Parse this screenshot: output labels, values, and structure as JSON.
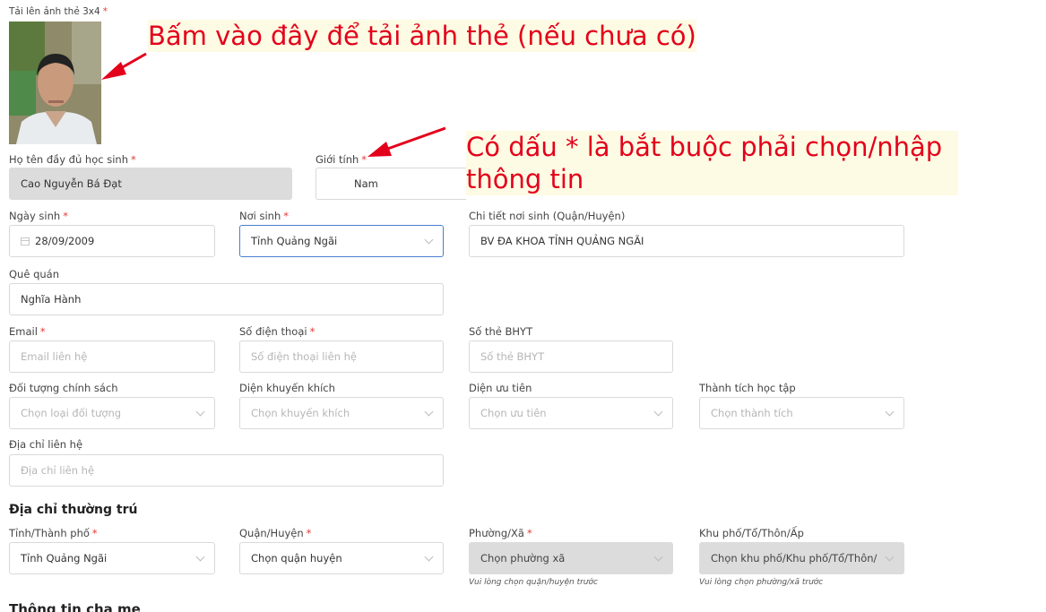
{
  "photo": {
    "label": "Tải lên ảnh thẻ 3x4",
    "required": "*"
  },
  "annotations": {
    "upload_hint": "Bấm vào đây để tải ảnh thẻ (nếu chưa có)",
    "required_hint_line1": "Có dấu * là bắt buộc phải chọn/nhập",
    "required_hint_line2": "thông tin"
  },
  "fields": {
    "full_name": {
      "label": "Họ tên đầy đủ học sinh",
      "required": "*",
      "value": "Cao Nguyễn Bá Đạt"
    },
    "gender": {
      "label": "Giới tính",
      "required": "*",
      "value": "Nam"
    },
    "dob": {
      "label": "Ngày sinh",
      "required": "*",
      "value": "28/09/2009"
    },
    "birthplace": {
      "label": "Nơi sinh",
      "required": "*",
      "value": "Tỉnh Quảng Ngãi"
    },
    "birthplace_detail": {
      "label": "Chi tiết nơi sinh (Quận/Huyện)",
      "value": "BV ĐA KHOA TỈNH QUẢNG NGÃI"
    },
    "hometown": {
      "label": "Quê quán",
      "value": "Nghĩa Hành"
    },
    "email": {
      "label": "Email",
      "required": "*",
      "placeholder": "Email liên hệ"
    },
    "phone": {
      "label": "Số điện thoại",
      "required": "*",
      "placeholder": "Số điện thoại liên hệ"
    },
    "insurance": {
      "label": "Số thẻ BHYT",
      "placeholder": "Số thẻ BHYT"
    },
    "policy": {
      "label": "Đối tượng chính sách",
      "placeholder": "Chọn loại đối tượng"
    },
    "encourage": {
      "label": "Diện khuyến khích",
      "placeholder": "Chọn khuyến khích"
    },
    "priority": {
      "label": "Diện ưu tiên",
      "placeholder": "Chọn ưu tiên"
    },
    "achievement": {
      "label": "Thành tích học tập",
      "placeholder": "Chọn thành tích"
    },
    "contact_address": {
      "label": "Địa chỉ liên hệ",
      "placeholder": "Địa chỉ liên hệ"
    }
  },
  "residence": {
    "title": "Địa chỉ thường trú",
    "province": {
      "label": "Tỉnh/Thành phố",
      "required": "*",
      "value": "Tỉnh Quảng Ngãi"
    },
    "district": {
      "label": "Quận/Huyện",
      "required": "*",
      "placeholder": "Chọn quận huyện"
    },
    "ward": {
      "label": "Phường/Xã",
      "required": "*",
      "placeholder": "Chọn phường xã",
      "hint": "Vui lòng chọn quận/huyện trước"
    },
    "hamlet": {
      "label": "Khu phố/Tổ/Thôn/Ấp",
      "placeholder": "Chọn khu phố/Khu phố/Tổ/Thôn/",
      "hint": "Vui lòng chọn phường/xã trước"
    }
  },
  "next_section": {
    "title": "Thông tin cha mẹ"
  },
  "colors": {
    "required": "#e53935",
    "callout_text": "#e3001b",
    "callout_bg": "#fdfbe3",
    "arrow": "#e3001b",
    "focus_border": "#4a7fd0"
  }
}
